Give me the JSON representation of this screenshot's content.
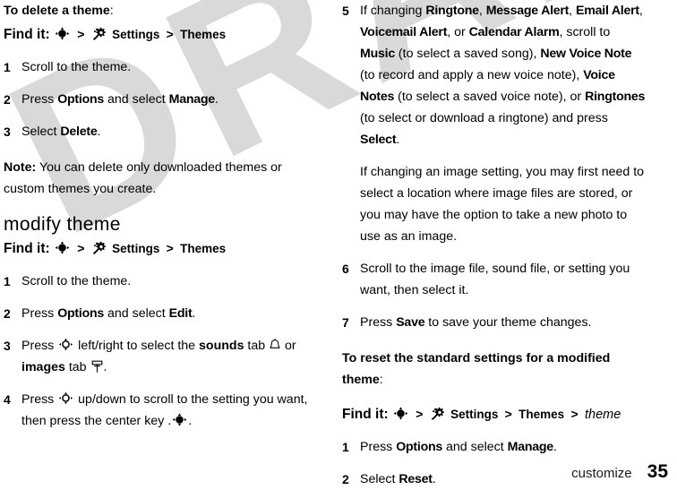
{
  "watermark": {
    "text": "DRAFT"
  },
  "footer": {
    "chapter": "customize",
    "page_number": "35"
  },
  "icons": {
    "nav_key_filled": "navigation-key-filled-icon",
    "nav_key_hollow": "navigation-key-hollow-icon",
    "settings_gear": "settings-gear-icon",
    "sounds_tab_bell": "bell-icon",
    "images_tab_roller": "paint-roller-icon"
  },
  "left_column": {
    "delete_heading": {
      "bold": "To delete a theme",
      "tail": ":"
    },
    "find_it_1": {
      "label": "Find it:",
      "sep": ">",
      "settings": "Settings",
      "themes": "Themes"
    },
    "steps_delete": [
      {
        "num": "1",
        "text_a": "Scroll to the theme."
      },
      {
        "num": "2",
        "text_a": "Press ",
        "ui_1": "Options",
        "text_b": " and select ",
        "ui_2": "Manage",
        "text_c": "."
      },
      {
        "num": "3",
        "text_a": "Select ",
        "ui_1": "Delete",
        "text_b": "."
      }
    ],
    "note": {
      "label": "Note:",
      "text": " You can delete only downloaded themes or custom themes you create."
    },
    "modify_title": "modify theme",
    "find_it_2": {
      "label": "Find it:",
      "sep": ">",
      "settings": "Settings",
      "themes": "Themes"
    },
    "steps_modify": [
      {
        "num": "1",
        "text_a": "Scroll to the theme."
      },
      {
        "num": "2",
        "text_a": "Press ",
        "ui_1": "Options",
        "text_b": " and select ",
        "ui_2": "Edit",
        "text_c": "."
      },
      {
        "num": "3",
        "text_a": "Press ",
        "text_b": " left/right to select the ",
        "tab_1": "sounds",
        "text_c": " tab ",
        "text_d": " or ",
        "tab_2": "images",
        "text_e": " tab ",
        "text_f": "."
      },
      {
        "num": "4",
        "text_a": "Press ",
        "text_b": " up/down to scroll to the setting you want, then press the center key .",
        "text_c": "."
      }
    ]
  },
  "right_column": {
    "step_5": {
      "num": "5",
      "text_a": "If changing ",
      "ui_1": "Ringtone",
      "text_b": ", ",
      "ui_2": "Message Alert",
      "text_c": ", ",
      "ui_3": "Email Alert",
      "text_d": ", ",
      "ui_4": "Voicemail Alert",
      "text_e": ", or ",
      "ui_5": "Calendar Alarm",
      "text_f": ", scroll to ",
      "ui_6": "Music",
      "text_g": " (to select a saved song), ",
      "ui_7": "New Voice Note",
      "text_h": " (to record and apply a new voice note), ",
      "ui_8": "Voice Notes",
      "text_i": " (to select a saved voice note), or ",
      "ui_9": "Ringtones",
      "text_j": " (to select or download a ringtone) and press ",
      "ui_10": "Select",
      "text_k": "."
    },
    "image_note": "If changing an image setting, you may first need to select a location where image files are stored, or you may have the option to take a new photo to use as an image.",
    "step_6": {
      "num": "6",
      "text_a": "Scroll to the image file, sound file, or setting you want, then select it."
    },
    "step_7": {
      "num": "7",
      "text_a": "Press ",
      "ui_1": "Save",
      "text_b": " to save your theme changes."
    },
    "reset_heading": {
      "bold": "To reset the standard settings for a modified theme",
      "tail": ":"
    },
    "find_it_3": {
      "label": "Find it:",
      "sep": ">",
      "settings": "Settings",
      "themes": "Themes",
      "theme_italic": "theme"
    },
    "steps_reset": [
      {
        "num": "1",
        "text_a": "Press ",
        "ui_1": "Options",
        "text_b": " and select ",
        "ui_2": "Manage",
        "text_c": "."
      },
      {
        "num": "2",
        "text_a": "Select ",
        "ui_1": "Reset",
        "text_b": "."
      }
    ]
  }
}
